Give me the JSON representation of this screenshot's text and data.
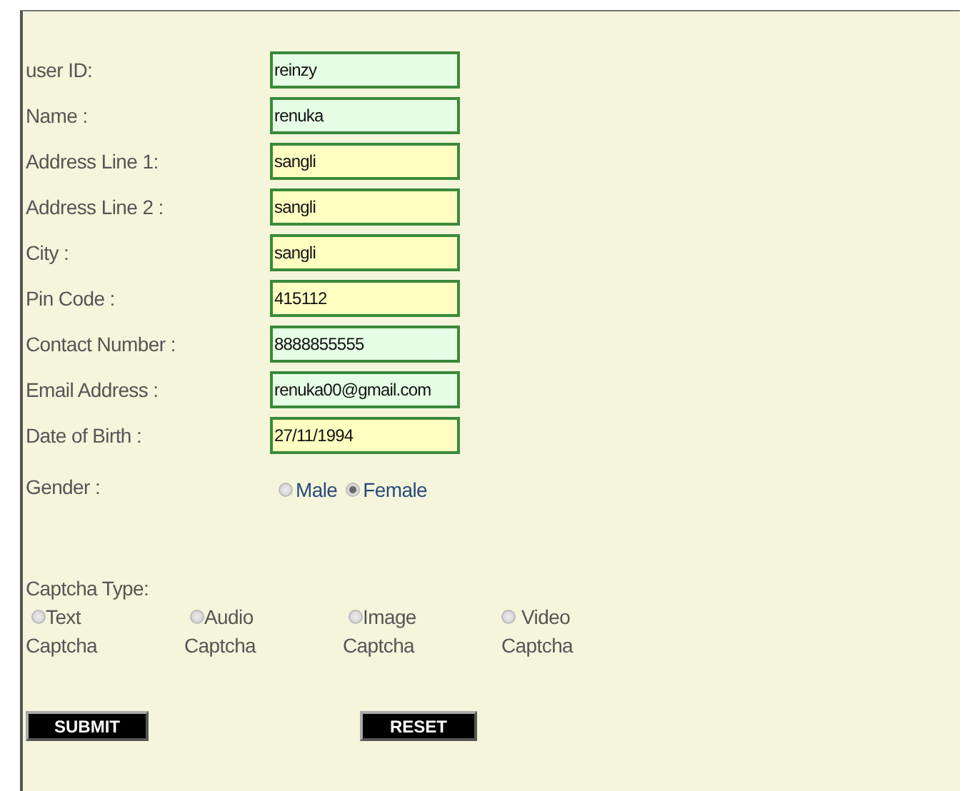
{
  "fields": [
    {
      "label": "user ID:",
      "value": "reinzy",
      "color": "#e6fde6"
    },
    {
      "label": "Name  :",
      "value": "renuka",
      "color": "#e6fde6"
    },
    {
      "label": "Address Line 1:",
      "value": "sangli",
      "color": "#ffffc2"
    },
    {
      "label": "Address Line 2 :",
      "value": "sangli",
      "color": "#ffffc2"
    },
    {
      "label": "City :",
      "value": "sangli",
      "color": "#ffffc2"
    },
    {
      "label": "Pin Code :",
      "value": "415112",
      "color": "#ffffc2"
    },
    {
      "label": "Contact Number :",
      "value": "8888855555",
      "color": "#e6fde6"
    },
    {
      "label": "Email Address :",
      "value": "renuka00@gmail.com",
      "color": "#e6fde6"
    },
    {
      "label": "Date of Birth :",
      "value": "27/11/1994",
      "color": "#ffffc2"
    }
  ],
  "gender": {
    "label": "Gender :",
    "options": [
      {
        "label": "Male",
        "selected": false
      },
      {
        "label": "Female",
        "selected": true
      }
    ]
  },
  "captcha": {
    "label": "Captcha Type:",
    "options": [
      {
        "label": "Text Captcha",
        "selected": false
      },
      {
        "label": "Audio Captcha",
        "selected": false
      },
      {
        "label": "Image Captcha",
        "selected": false
      },
      {
        "label": "Video Captcha",
        "selected": false
      }
    ]
  },
  "buttons": [
    "SUBMIT",
    "RESET"
  ]
}
